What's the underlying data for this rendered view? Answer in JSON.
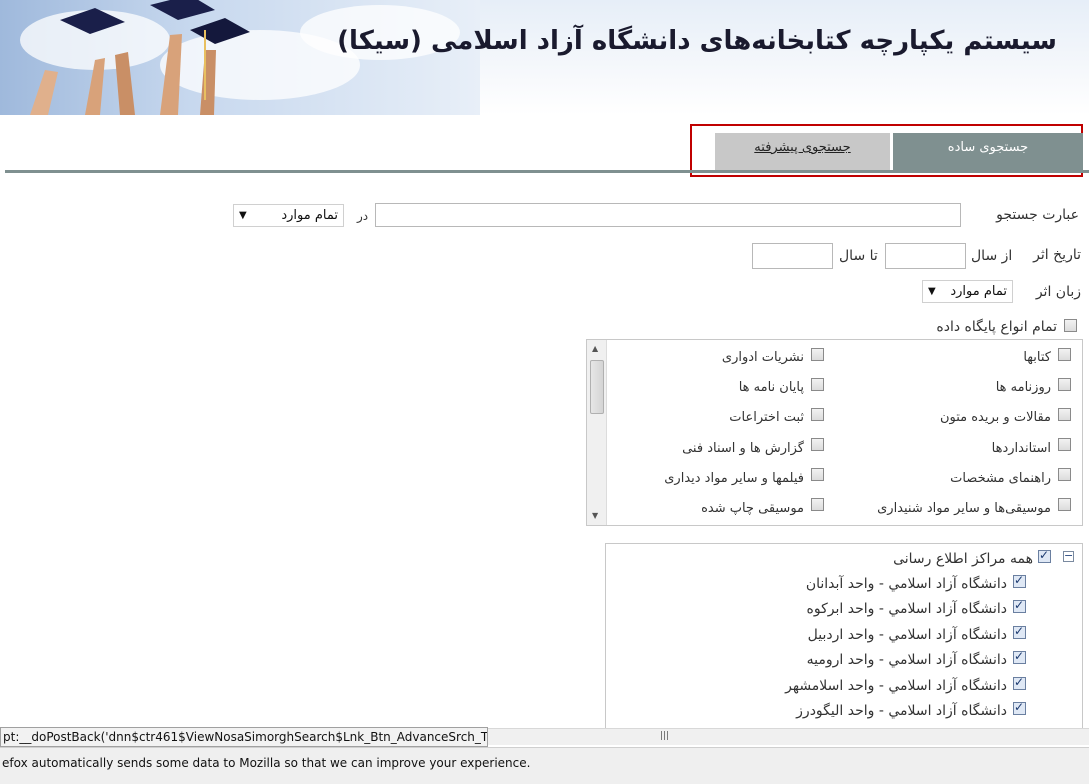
{
  "header": {
    "title": "سیستم یکپارچه کتابخانه‌های دانشگاه آزاد اسلامی (سیکا)"
  },
  "tabs": {
    "simple_label": "جستجوی ساده",
    "advanced_label": "جستجوی پیشرفته"
  },
  "search": {
    "phrase_label": "عبارت جستجو",
    "in_label": "در",
    "field_select_value": "تمام موارد",
    "phrase_value": ""
  },
  "date": {
    "label": "تاریخ اثر",
    "from_label": "از سال",
    "to_label": "تا سال",
    "from_value": "",
    "to_value": ""
  },
  "language": {
    "label": "زبان اثر",
    "select_value": "تمام موارد"
  },
  "databases": {
    "all_label": "تمام انواع پایگاه داده",
    "right_column": [
      "کتابها",
      "روزنامه ها",
      "مقالات و بریده متون",
      "استانداردها",
      "راهنمای مشخصات",
      "موسیقی‌ها و سایر مواد شنیداری"
    ],
    "left_column": [
      "نشریات ادواری",
      "پایان نامه ها",
      "ثبت اختراعات",
      "گزارش ها و اسناد فنی",
      "فیلمها و سایر مواد دیداری",
      "موسیقی چاپ شده"
    ]
  },
  "centers": {
    "all_label": "همه مراکز اطلاع رسانی",
    "items": [
      "دانشگاه آزاد اسلامي - واحد آبدانان",
      "دانشگاه آزاد اسلامي - واحد ابركوه",
      "دانشگاه آزاد اسلامي - واحد اردبيل",
      "دانشگاه آزاد اسلامي - واحد اروميه",
      "دانشگاه آزاد اسلامي - واحد اسلامشهر",
      "دانشگاه آزاد اسلامي - واحد اليگودرز"
    ]
  },
  "browser": {
    "status_url": "pt:__doPostBack('dnn$ctr461$ViewNosaSimorghSearch$Lnk_Btn_AdvanceSrch_Tab','')",
    "notification": "efox automatically sends some data to Mozilla so that we can improve your experience."
  },
  "colors": {
    "tab_active": "#7f9090",
    "tab_inactive": "#c8c8c8",
    "highlight": "#c00000"
  }
}
